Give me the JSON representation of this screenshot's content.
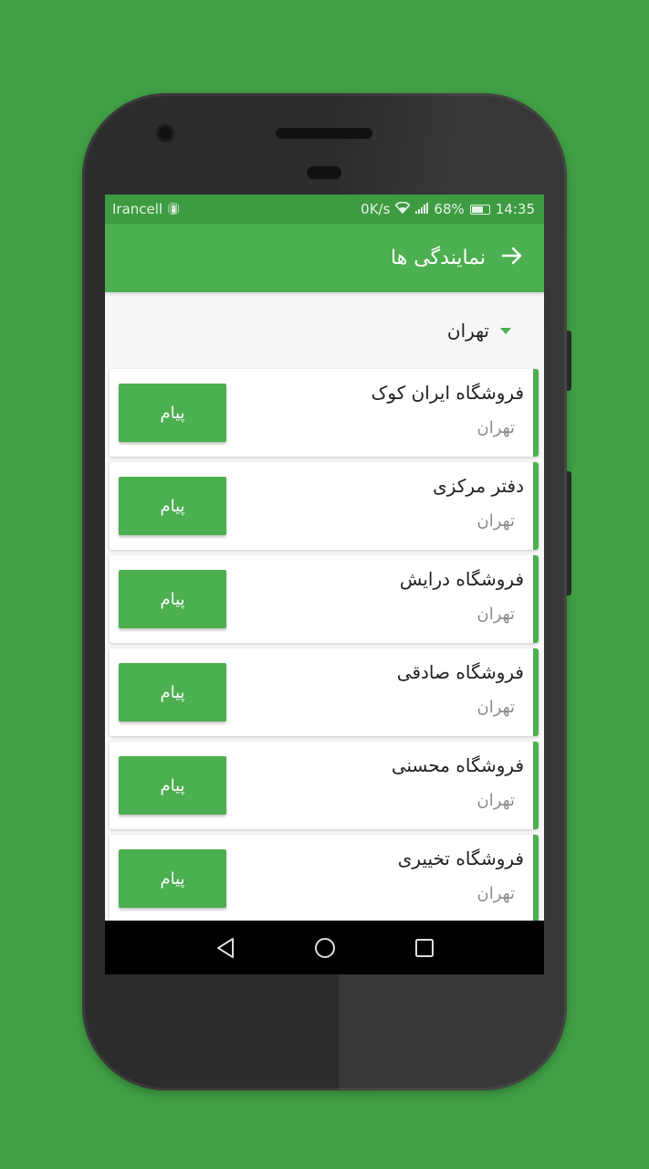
{
  "status_bar": {
    "carrier": "Irancell",
    "speed": "0K/s",
    "battery": "68%",
    "time": "14:35"
  },
  "app_bar": {
    "title": "نمایندگی ها",
    "back_icon": "arrow-right-icon"
  },
  "filter": {
    "selected": "تهران",
    "icon": "dropdown-caret-icon"
  },
  "dealers": [
    {
      "name": "فروشگاه ایران کوک",
      "city": "تهران",
      "button": "پیام"
    },
    {
      "name": "دفتر مرکزی",
      "city": "تهران",
      "button": "پیام"
    },
    {
      "name": "فروشگاه درایش",
      "city": "تهران",
      "button": "پیام"
    },
    {
      "name": "فروشگاه صادقی",
      "city": "تهران",
      "button": "پیام"
    },
    {
      "name": "فروشگاه محسنی",
      "city": "تهران",
      "button": "پیام"
    },
    {
      "name": "فروشگاه تخییری",
      "city": "تهران",
      "button": "پیام"
    }
  ],
  "nav_bar": {
    "back_icon": "nav-back-icon",
    "home_icon": "nav-home-icon",
    "recents_icon": "nav-recents-icon"
  },
  "colors": {
    "background": "#41a046",
    "accent": "#4caf50",
    "status_bar": "#3d9c41"
  }
}
